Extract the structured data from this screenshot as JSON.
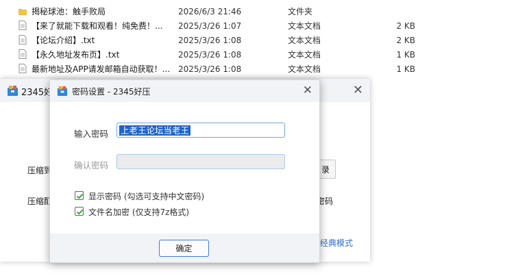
{
  "files": [
    {
      "name": "揭秘球池：触手败局",
      "date": "2026/6/3 21:46",
      "type": "文件夹",
      "size": "",
      "icon": "folder-icon"
    },
    {
      "name": "【来了就能下载和观看！纯免费！...",
      "date": "2025/3/26 1:07",
      "type": "文本文档",
      "size": "2 KB",
      "icon": "text-file-icon"
    },
    {
      "name": "【论坛介绍】.txt",
      "date": "2025/3/26 1:08",
      "type": "文本文档",
      "size": "2 KB",
      "icon": "text-file-icon"
    },
    {
      "name": "【永久地址发布页】.txt",
      "date": "2025/3/26 1:08",
      "type": "文本文档",
      "size": "1 KB",
      "icon": "text-file-icon"
    },
    {
      "name": "最新地址及APP请发邮箱自动获取！...",
      "date": "2025/3/26 1:08",
      "type": "文本文档",
      "size": "1 KB",
      "icon": "text-file-icon"
    }
  ],
  "bg_window": {
    "title": "2345好",
    "label_compress": "压缩到",
    "label_compress_method": "压缩酊",
    "btn_partial": "录",
    "pwd_partial": "密码",
    "classic_mode": "经典模式"
  },
  "dialog": {
    "title": "密码设置 - 2345好压",
    "enter_password_label": "输入密码",
    "password_value": "上老王论坛当老王",
    "confirm_password_label": "确认密码",
    "confirm_password_value": "",
    "show_password": {
      "label": "显示密码 (勾选可支持中文密码)",
      "checked": true
    },
    "encrypt_filenames": {
      "label": "文件名加密 (仅支持7z格式)",
      "checked": true
    },
    "ok_button": "确定"
  },
  "colors": {
    "accent": "#3e7bd3",
    "selection": "#1e63c6",
    "check": "#2e9a2e",
    "folder": "#f4c542"
  }
}
